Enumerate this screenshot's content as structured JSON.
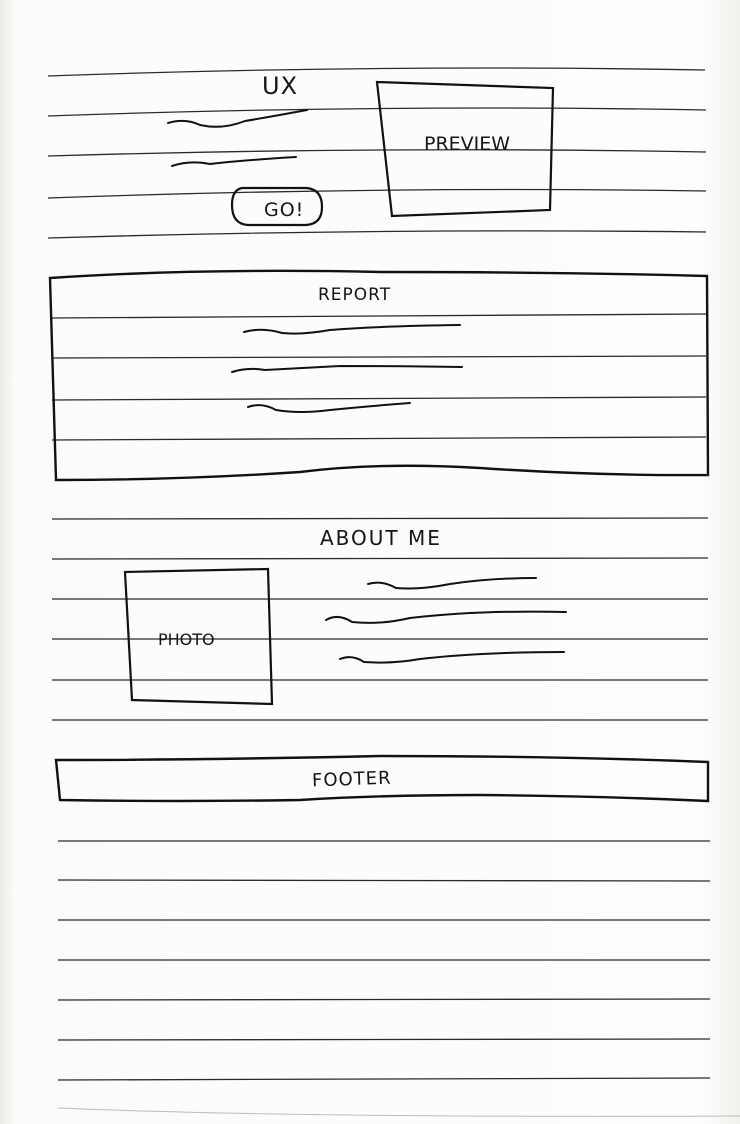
{
  "header": {
    "title": "UX",
    "preview_label": "PREVIEW",
    "cta_label": "GO!"
  },
  "report": {
    "title": "REPORT"
  },
  "about": {
    "title": "ABOUT ME",
    "photo_label": "PHOTO"
  },
  "footer": {
    "label": "FOOTER"
  },
  "colors": {
    "paper": "#fdfdfc",
    "ink": "#151515",
    "rule_line": "#2a2a2a"
  }
}
